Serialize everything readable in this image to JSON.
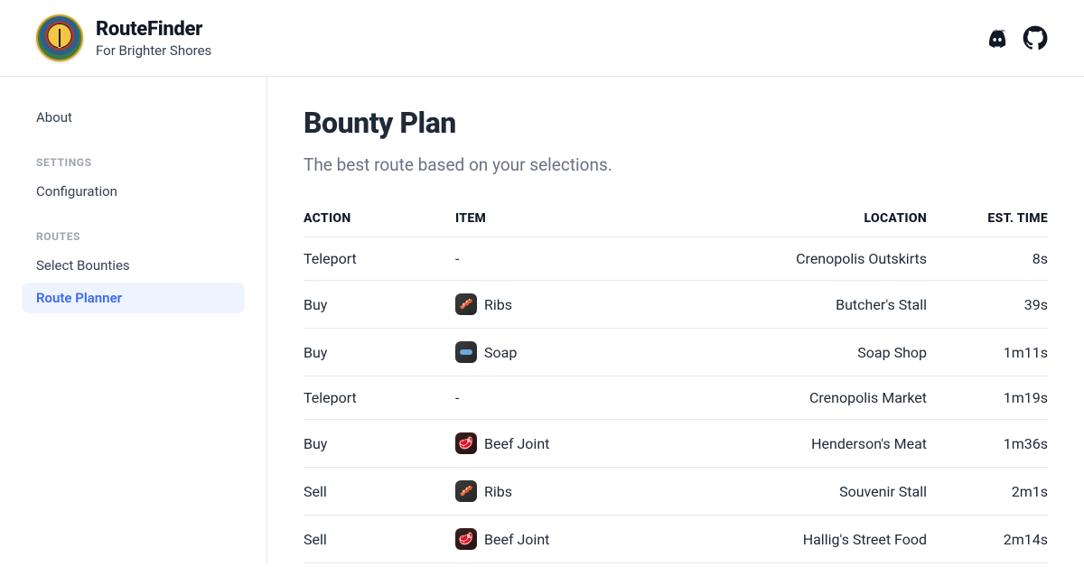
{
  "header": {
    "title": "RouteFinder",
    "subtitle": "For Brighter Shores"
  },
  "sidebar": {
    "about_label": "About",
    "section_settings": "SETTINGS",
    "config_label": "Configuration",
    "section_routes": "ROUTES",
    "select_bounties_label": "Select Bounties",
    "route_planner_label": "Route Planner"
  },
  "main": {
    "title": "Bounty Plan",
    "subtitle": "The best route based on your selections.",
    "columns": {
      "action": "ACTION",
      "item": "ITEM",
      "location": "LOCATION",
      "time": "EST. TIME"
    },
    "rows": [
      {
        "action": "Teleport",
        "item": "-",
        "icon": "",
        "location": "Crenopolis Outskirts",
        "time": "8s"
      },
      {
        "action": "Buy",
        "item": "Ribs",
        "icon": "ribs",
        "location": "Butcher's Stall",
        "time": "39s"
      },
      {
        "action": "Buy",
        "item": "Soap",
        "icon": "soap",
        "location": "Soap Shop",
        "time": "1m11s"
      },
      {
        "action": "Teleport",
        "item": "-",
        "icon": "",
        "location": "Crenopolis Market",
        "time": "1m19s"
      },
      {
        "action": "Buy",
        "item": "Beef Joint",
        "icon": "beef",
        "location": "Henderson's Meat",
        "time": "1m36s"
      },
      {
        "action": "Sell",
        "item": "Ribs",
        "icon": "ribs",
        "location": "Souvenir Stall",
        "time": "2m1s"
      },
      {
        "action": "Sell",
        "item": "Beef Joint",
        "icon": "beef",
        "location": "Hallig's Street Food",
        "time": "2m14s"
      }
    ]
  }
}
